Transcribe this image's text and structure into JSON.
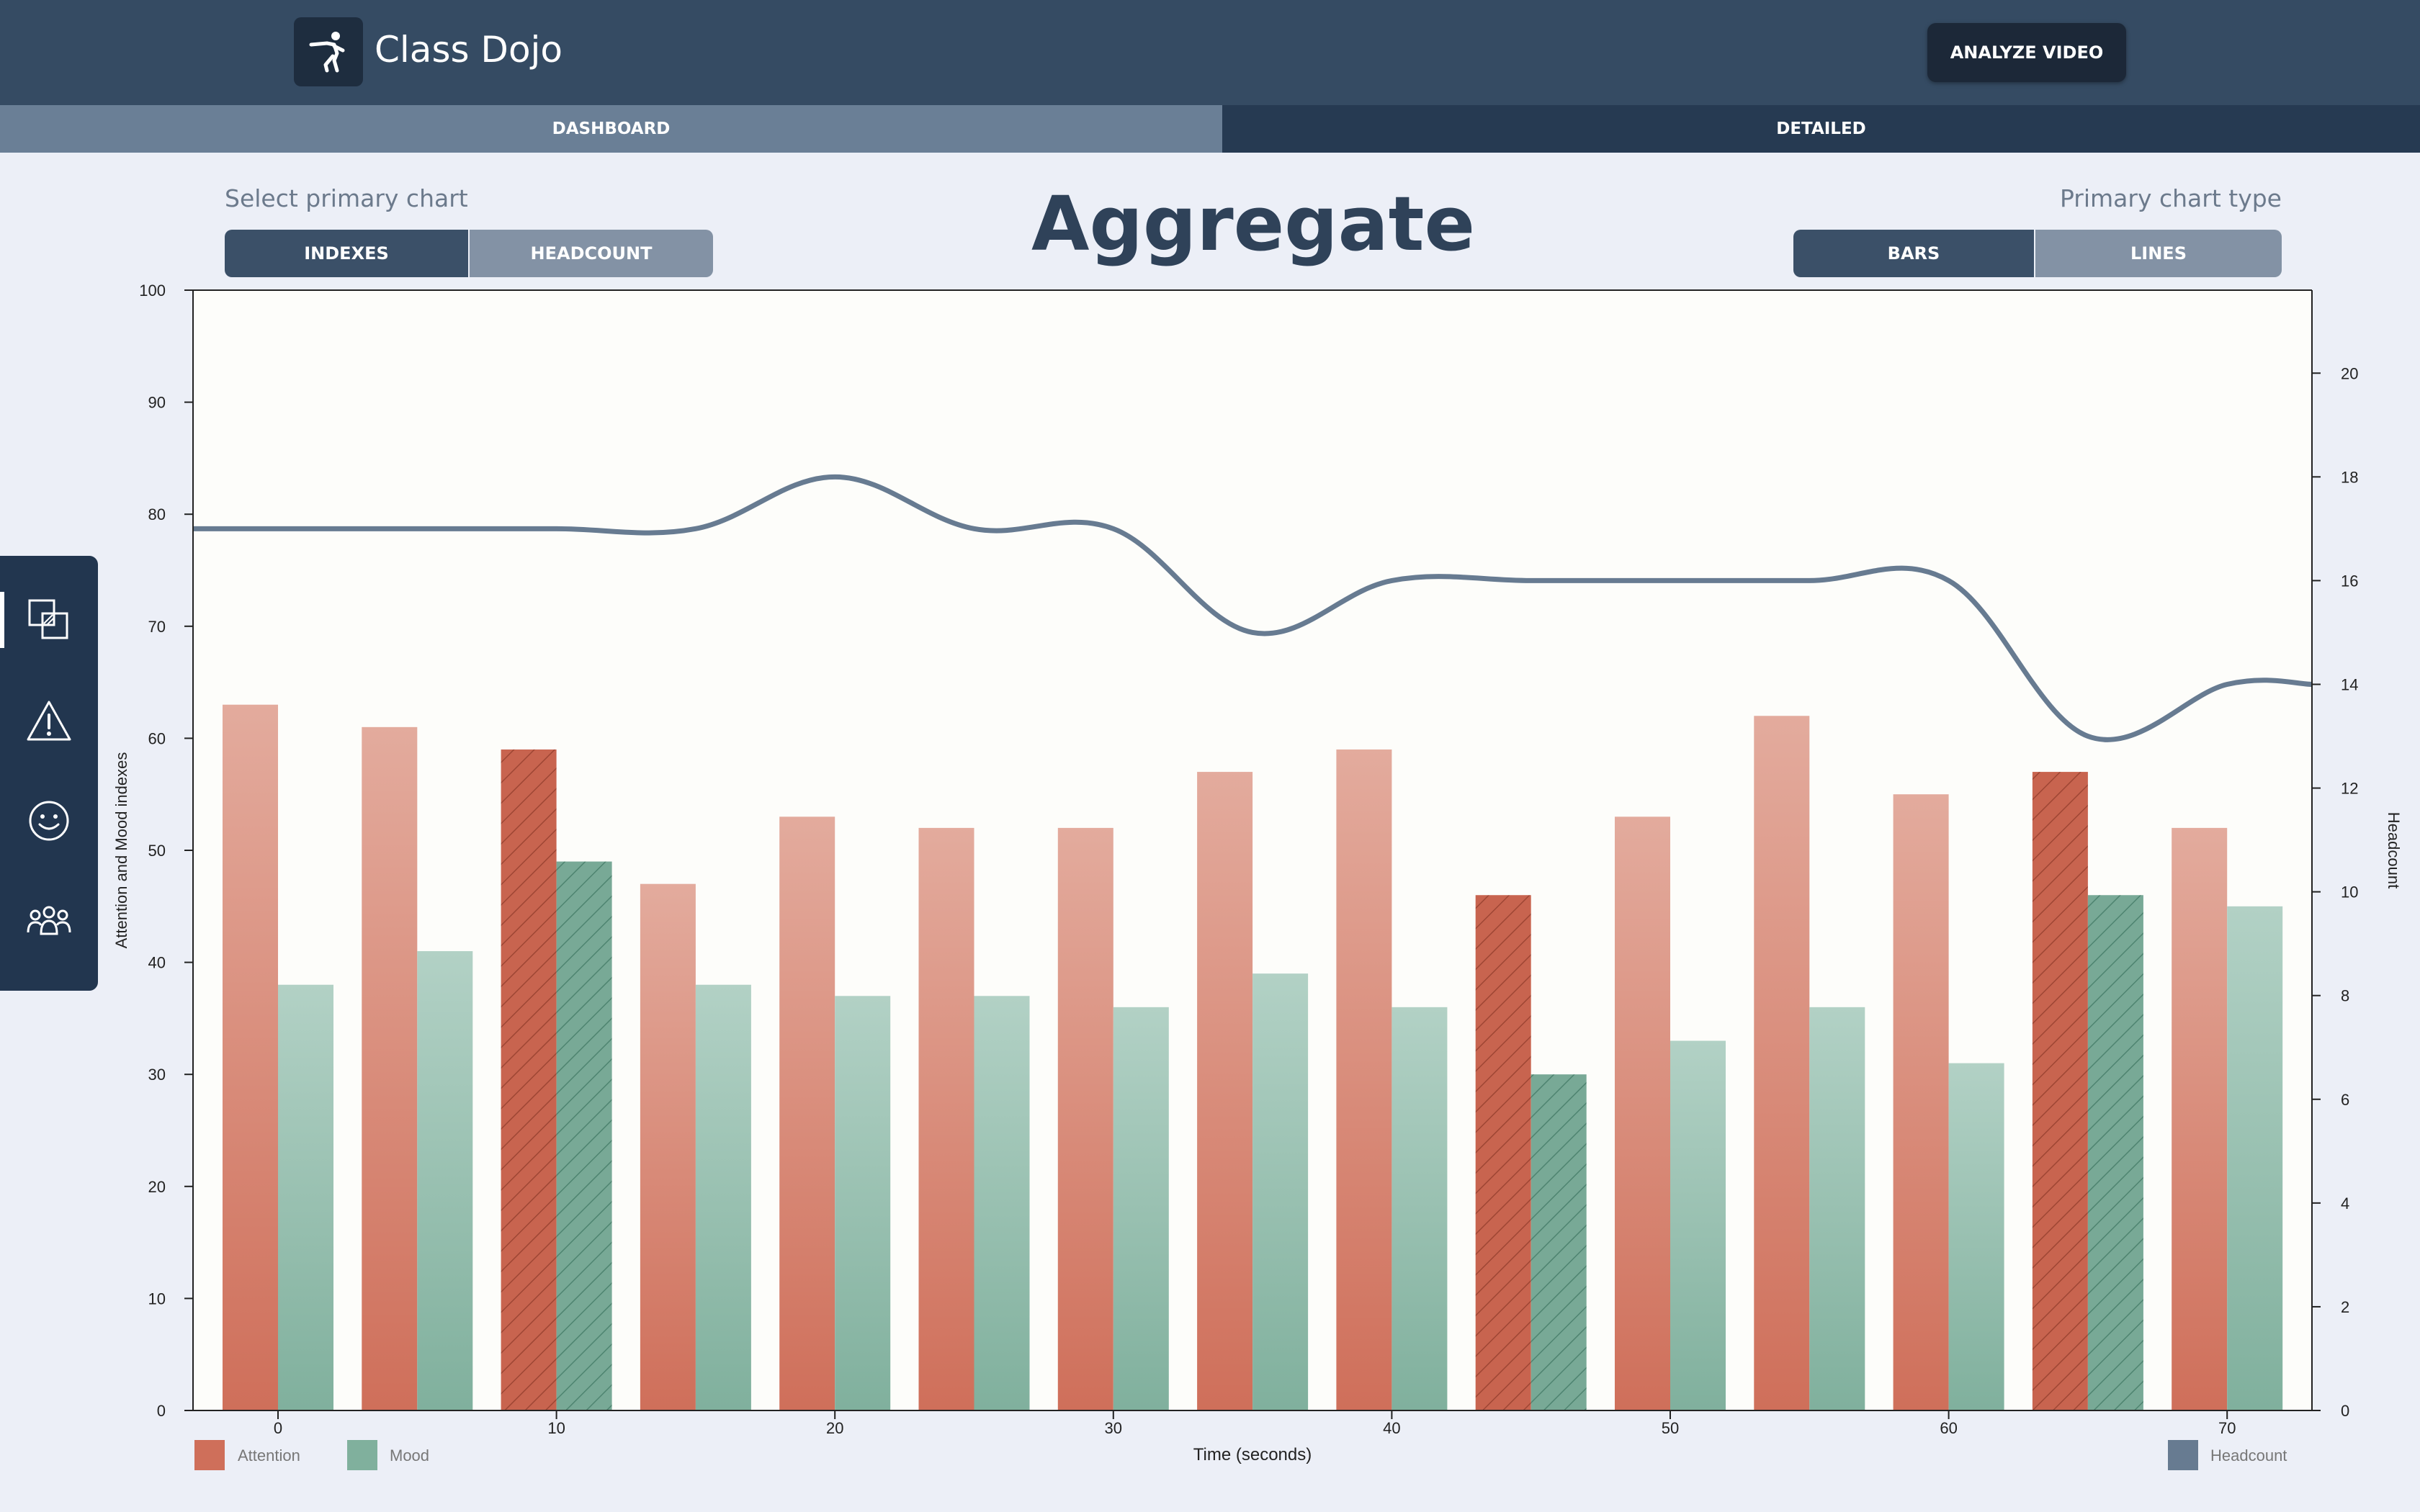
{
  "header": {
    "app_title": "Class Dojo",
    "logo_icon": "martial-arts-kick-icon",
    "analyze_button": "ANALYZE VIDEO"
  },
  "nav": {
    "tabs": [
      {
        "label": "DASHBOARD",
        "active": false
      },
      {
        "label": "DETAILED",
        "active": true
      }
    ]
  },
  "controls": {
    "primary_chart_label": "Select primary chart",
    "primary_chart_options": [
      "INDEXES",
      "HEADCOUNT"
    ],
    "primary_chart_selected": "INDEXES",
    "chart_type_label": "Primary chart type",
    "chart_type_options": [
      "BARS",
      "LINES"
    ],
    "chart_type_selected": "BARS"
  },
  "page_title": "Aggregate",
  "sidebar": {
    "items": [
      {
        "icon": "overlapping-squares-icon",
        "active": true
      },
      {
        "icon": "warning-icon",
        "active": false
      },
      {
        "icon": "smiley-face-icon",
        "active": false
      },
      {
        "icon": "group-people-icon",
        "active": false
      }
    ]
  },
  "colors": {
    "attention": "#CF6F5A",
    "attention_light": "#E3AB9D",
    "mood": "#80B09D",
    "mood_light": "#B2D1C5",
    "headcount": "#677B91",
    "header_bg": "#354B63",
    "page_bg": "#ECEFF7",
    "plot_bg": "#FDFDFA"
  },
  "chart_data": {
    "type": "bar",
    "xlabel": "Time (seconds)",
    "ylabel": "Attention and Mood indexes",
    "y2label": "Headcount",
    "x": [
      0,
      5,
      10,
      15,
      20,
      25,
      30,
      35,
      40,
      45,
      50,
      55,
      60,
      65,
      70
    ],
    "x_ticks": [
      0,
      10,
      20,
      30,
      40,
      50,
      60,
      70
    ],
    "ylim": [
      0,
      100
    ],
    "y_ticks": [
      0,
      10,
      20,
      30,
      40,
      50,
      60,
      70,
      80,
      90,
      100
    ],
    "y2lim": [
      0,
      21.6
    ],
    "y2_ticks": [
      0,
      2,
      4,
      6,
      8,
      10,
      12,
      14,
      16,
      18,
      20
    ],
    "series": [
      {
        "name": "Attention",
        "type": "bar",
        "axis": "left",
        "values": [
          63,
          61,
          59,
          47,
          53,
          52,
          52,
          57,
          59,
          46,
          53,
          62,
          55,
          57,
          52
        ]
      },
      {
        "name": "Mood",
        "type": "bar",
        "axis": "left",
        "values": [
          38,
          41,
          49,
          38,
          37,
          37,
          36,
          39,
          36,
          30,
          33,
          36,
          31,
          46,
          45
        ]
      },
      {
        "name": "Headcount",
        "type": "line",
        "axis": "right",
        "values": [
          17,
          17,
          17,
          17,
          18,
          17,
          17,
          15,
          16,
          16,
          16,
          16,
          16,
          13,
          14
        ]
      }
    ],
    "highlighted_x": [
      10,
      45,
      65
    ],
    "legend": {
      "left": [
        "Attention",
        "Mood"
      ],
      "right": [
        "Headcount"
      ],
      "placement": "bottom"
    },
    "grid": false
  }
}
